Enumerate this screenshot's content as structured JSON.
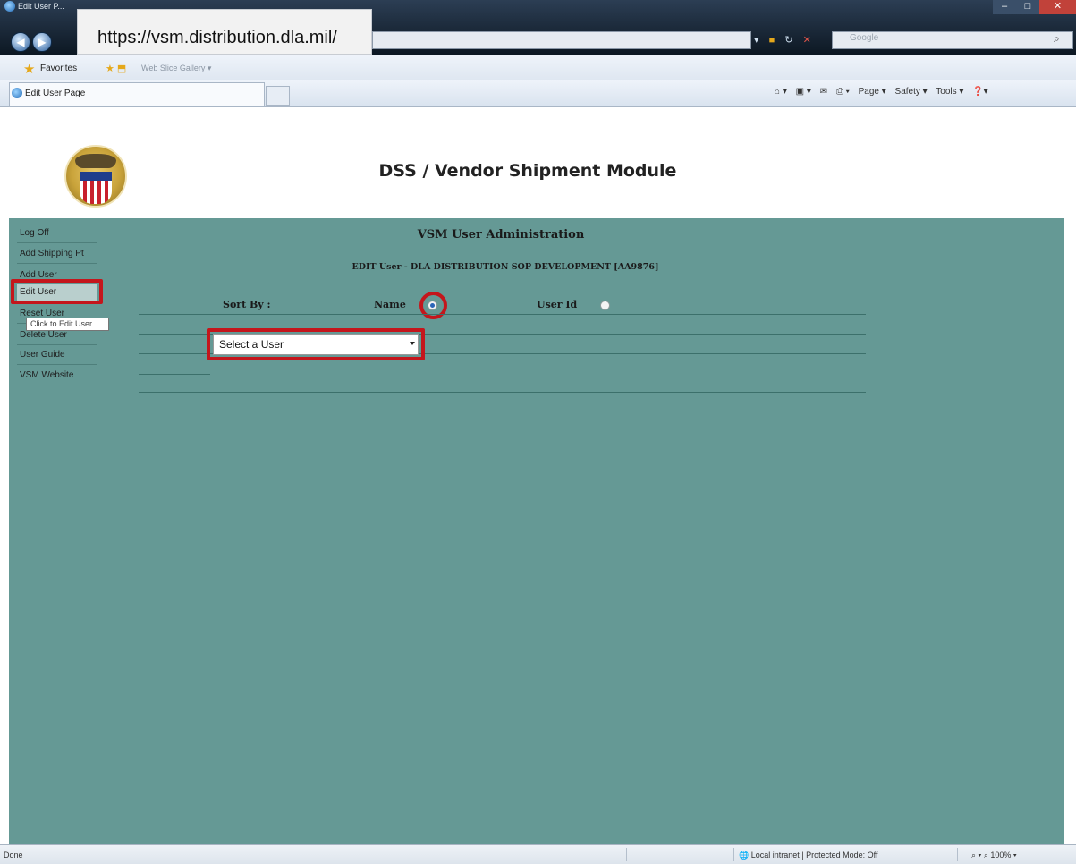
{
  "browser": {
    "window_title": "Edit User P...",
    "address": "https://vsm.distribution.dla.mil/",
    "search_placeholder": "Google",
    "favorites_label": "Favorites",
    "web_slice_label": "Web Slice Gallery ▾",
    "tab_title": "Edit User Page",
    "commands": [
      "Page ▾",
      "Safety ▾",
      "Tools ▾"
    ],
    "status_left": "Done",
    "status_zone": "Local intranet | Protected Mode: Off",
    "status_zoom": "100%"
  },
  "header": {
    "app_title": "DSS / Vendor Shipment Module"
  },
  "sidebar": {
    "items": [
      {
        "label": "Log Off"
      },
      {
        "label": "Add Shipping Pt"
      },
      {
        "label": "Add User"
      },
      {
        "label": "Edit User"
      },
      {
        "label": "Reset User"
      },
      {
        "label": "Delete User"
      },
      {
        "label": "User Guide"
      },
      {
        "label": "VSM Website"
      }
    ],
    "tooltip": "Click to Edit User"
  },
  "main": {
    "section_title": "VSM User Administration",
    "edit_heading": "EDIT User - DLA DISTRIBUTION SOP DEVELOPMENT [AA9876]",
    "sort_by_label": "Sort By :",
    "sort_options": [
      {
        "label": "Name",
        "selected": true
      },
      {
        "label": "User Id",
        "selected": false
      }
    ],
    "user_select_value": "Select a User"
  },
  "colors": {
    "content_bg": "#659995",
    "highlight": "#c4161c"
  }
}
